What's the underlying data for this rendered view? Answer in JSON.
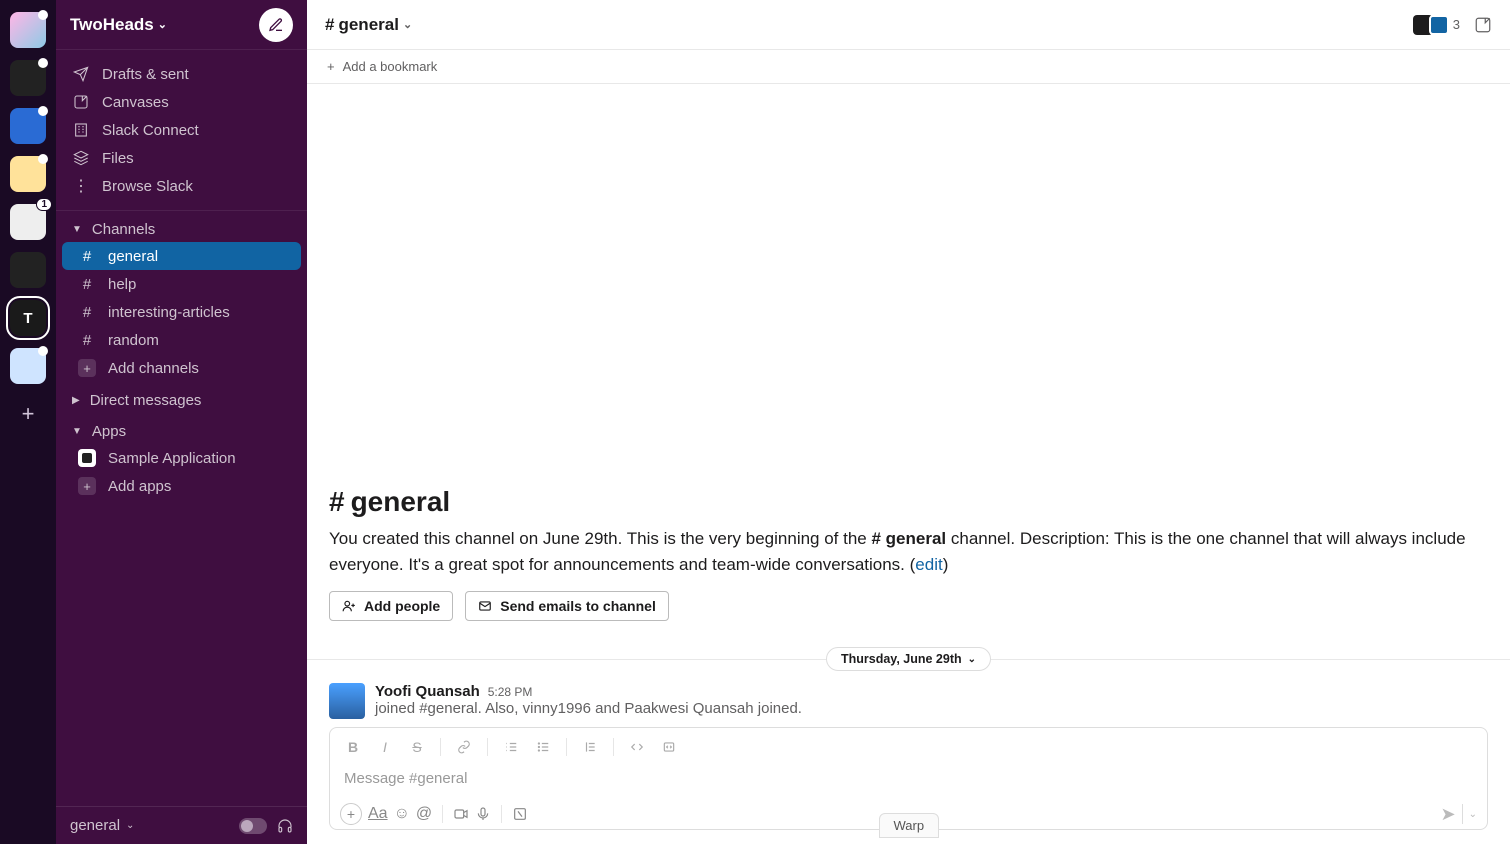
{
  "workspace_rail": {
    "items": [
      {
        "id": "ws1",
        "letter": "",
        "dot": true
      },
      {
        "id": "ws2",
        "letter": "",
        "dot": true,
        "community": true
      },
      {
        "id": "ws3",
        "letter": "",
        "dot": true
      },
      {
        "id": "ws4",
        "letter": "",
        "dot": true
      },
      {
        "id": "ws5",
        "letter": "",
        "badge": "1"
      },
      {
        "id": "ws6",
        "letter": "",
        "dot": false
      },
      {
        "id": "ws7",
        "letter": "T",
        "selected": true
      },
      {
        "id": "ws8",
        "letter": "",
        "dot": true
      }
    ],
    "add_label": "+"
  },
  "sidebar": {
    "workspace_name": "TwoHeads",
    "nav": [
      {
        "icon": "send",
        "label": "Drafts & sent"
      },
      {
        "icon": "canvas",
        "label": "Canvases"
      },
      {
        "icon": "connect",
        "label": "Slack Connect"
      },
      {
        "icon": "files",
        "label": "Files"
      },
      {
        "icon": "more",
        "label": "Browse Slack"
      }
    ],
    "sections": {
      "channels_label": "Channels",
      "dm_label": "Direct messages",
      "apps_label": "Apps"
    },
    "channels": [
      {
        "name": "general",
        "active": true
      },
      {
        "name": "help"
      },
      {
        "name": "interesting-articles"
      },
      {
        "name": "random"
      }
    ],
    "add_channels": "Add channels",
    "apps": [
      {
        "name": "Sample Application"
      }
    ],
    "add_apps": "Add apps",
    "footer_channel": "general"
  },
  "header": {
    "channel_name": "general",
    "member_count": "3"
  },
  "bookmark": {
    "add_label": "Add a bookmark"
  },
  "welcome": {
    "heading_prefix": "#",
    "heading_name": "general",
    "desc_part1": "You created this channel on June 29th. This is the very beginning of the ",
    "channel_ref": "# general",
    "desc_part2": " channel. Description: This is the one channel that will always include everyone. It's a great spot for announcements and team-wide conversations. (",
    "edit_label": "edit",
    "desc_part3": ")",
    "add_people": "Add people",
    "send_emails": "Send emails to channel"
  },
  "divider": {
    "date_label": "Thursday, June 29th"
  },
  "message": {
    "author": "Yoofi Quansah",
    "time": "5:28 PM",
    "body": "joined #general. Also, vinny1996 and Paakwesi Quansah joined."
  },
  "composer": {
    "placeholder": "Message #general"
  },
  "warp_label": "Warp"
}
